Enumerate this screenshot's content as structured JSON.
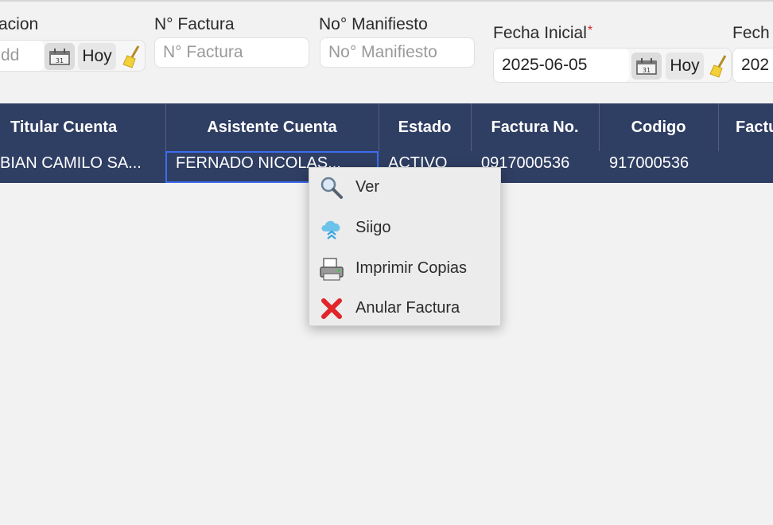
{
  "filters": [
    {
      "label": "acion",
      "placeholder": "dd",
      "today": "Hoy"
    },
    {
      "label": "N° Factura",
      "placeholder": "N° Factura"
    },
    {
      "label": "No° Manifiesto",
      "placeholder": "No° Manifiesto"
    },
    {
      "label": "Fecha Inicial",
      "required_mark": "*",
      "value": "2025-06-05",
      "today": "Hoy"
    },
    {
      "label": "Fech",
      "value": "202"
    }
  ],
  "table": {
    "columns": [
      "Titular Cuenta",
      "Asistente Cuenta",
      "Estado",
      "Factura No.",
      "Codigo",
      "Factu"
    ],
    "rows": [
      [
        "BIAN CAMILO SA...",
        "FERNADO NICOLAS...",
        "ACTIVO",
        "0917000536",
        "917000536",
        ""
      ]
    ]
  },
  "context_menu": [
    {
      "label": "Ver",
      "icon": "magnifier-icon"
    },
    {
      "label": "Siigo",
      "icon": "cloud-icon"
    },
    {
      "label": "Imprimir Copias",
      "icon": "printer-icon"
    },
    {
      "label": "Anular Factura",
      "icon": "red-x-icon"
    }
  ],
  "colors": {
    "table_header": "#2f3e63",
    "selected_border": "#3d6cf0",
    "required": "#dd2222",
    "cancel_red": "#e0252b"
  }
}
